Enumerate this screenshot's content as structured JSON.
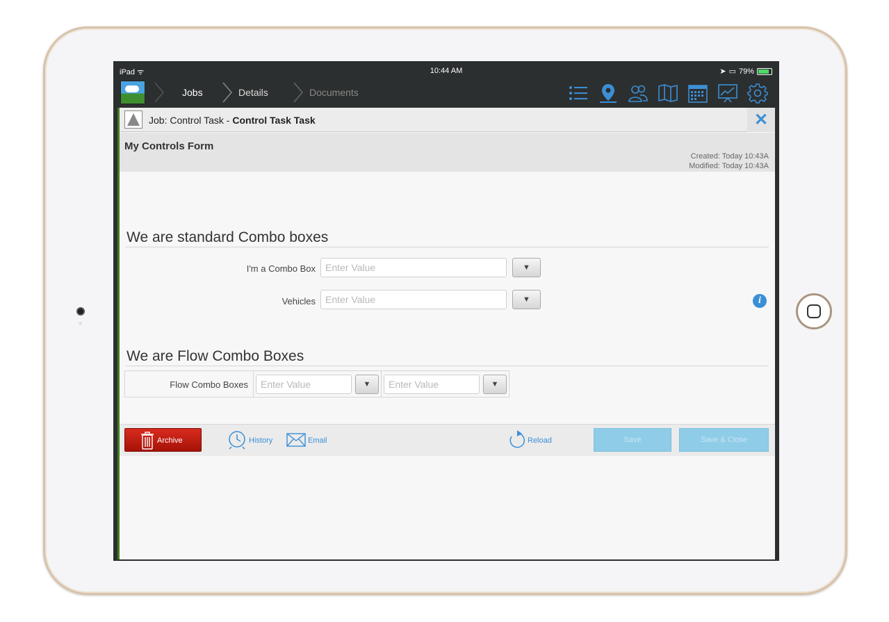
{
  "status_bar": {
    "device": "iPad",
    "time": "10:44 AM",
    "battery": "79%"
  },
  "nav": {
    "breadcrumbs": [
      "Jobs",
      "Details",
      "Documents"
    ],
    "icons": [
      "list-icon",
      "map-pin-icon",
      "users-icon",
      "map-icon",
      "calendar-icon",
      "chart-icon",
      "gear-icon"
    ],
    "accent": "#3b8fd6"
  },
  "job_bar": {
    "prefix": "Job: Control Task - ",
    "task": "Control Task Task"
  },
  "form": {
    "name": "My Controls Form",
    "created": "Created: Today 10:43A",
    "modified": "Modified: Today 10:43A"
  },
  "standard_section": {
    "title": "We are standard Combo boxes",
    "fields": [
      {
        "label": "I'm a Combo Box",
        "placeholder": "Enter Value"
      },
      {
        "label": "Vehicles",
        "placeholder": "Enter Value"
      }
    ]
  },
  "flow_section": {
    "title": "We are Flow Combo Boxes",
    "label": "Flow Combo Boxes",
    "placeholders": [
      "Enter Value",
      "Enter Value"
    ]
  },
  "toolbar": {
    "archive": "Archive",
    "history": "History",
    "email": "Email",
    "reload": "Reload",
    "save": "Save",
    "save_close": "Save & Close"
  }
}
